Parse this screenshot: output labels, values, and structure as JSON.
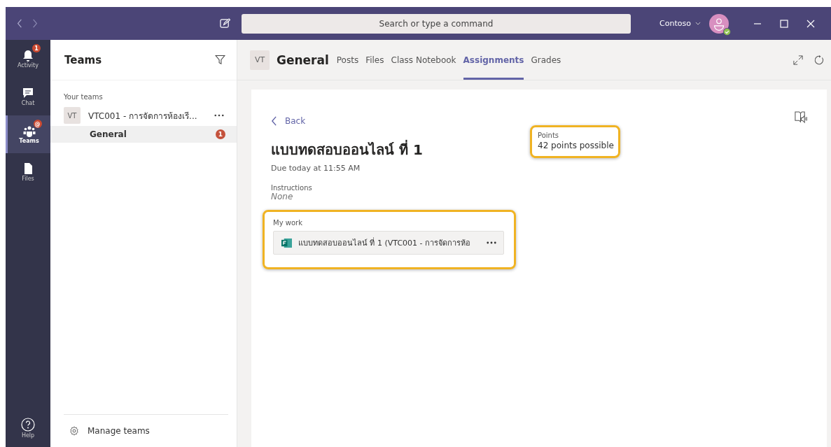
{
  "title_bar": {
    "search": {
      "placeholder": "Search or type a command"
    },
    "org": "Contoso"
  },
  "app_bar": [
    {
      "label": "Activity",
      "kind": "bell",
      "badge": "1",
      "selected": false
    },
    {
      "label": "Chat",
      "kind": "chat",
      "selected": false
    },
    {
      "label": "Teams",
      "kind": "teams",
      "badge": "@",
      "selected": true
    },
    {
      "label": "Files",
      "kind": "file",
      "selected": false
    }
  ],
  "help": {
    "label": "Help"
  },
  "teams_panel": {
    "title": "Teams",
    "section": "Your teams",
    "teams": [
      {
        "avatar": "VT",
        "name": "VTC001 - การจัดการห้องเรี...",
        "channels": [
          {
            "name": "General",
            "badge": "1",
            "selected": true
          }
        ]
      }
    ],
    "manage": "Manage teams"
  },
  "channel_header": {
    "avatar": "VT",
    "name": "General",
    "tabs": [
      {
        "label": "Posts",
        "selected": false
      },
      {
        "label": "Files",
        "selected": false
      },
      {
        "label": "Class Notebook",
        "selected": false
      },
      {
        "label": "Assignments",
        "selected": true
      },
      {
        "label": "Grades",
        "selected": false
      }
    ]
  },
  "assignment": {
    "back": "Back",
    "title": "แบบทดสอบออนไลน์ ที่ 1",
    "due": "Due today at 11:55 AM",
    "instructions_label": "Instructions",
    "instructions": "None",
    "points_label": "Points",
    "points": "42 points possible",
    "highlighted": true,
    "my_work_label": "My work",
    "work_file": "แบบทดสอบออนไลน์ ที่ 1 (VTC001 - การจัดการห้อ"
  }
}
